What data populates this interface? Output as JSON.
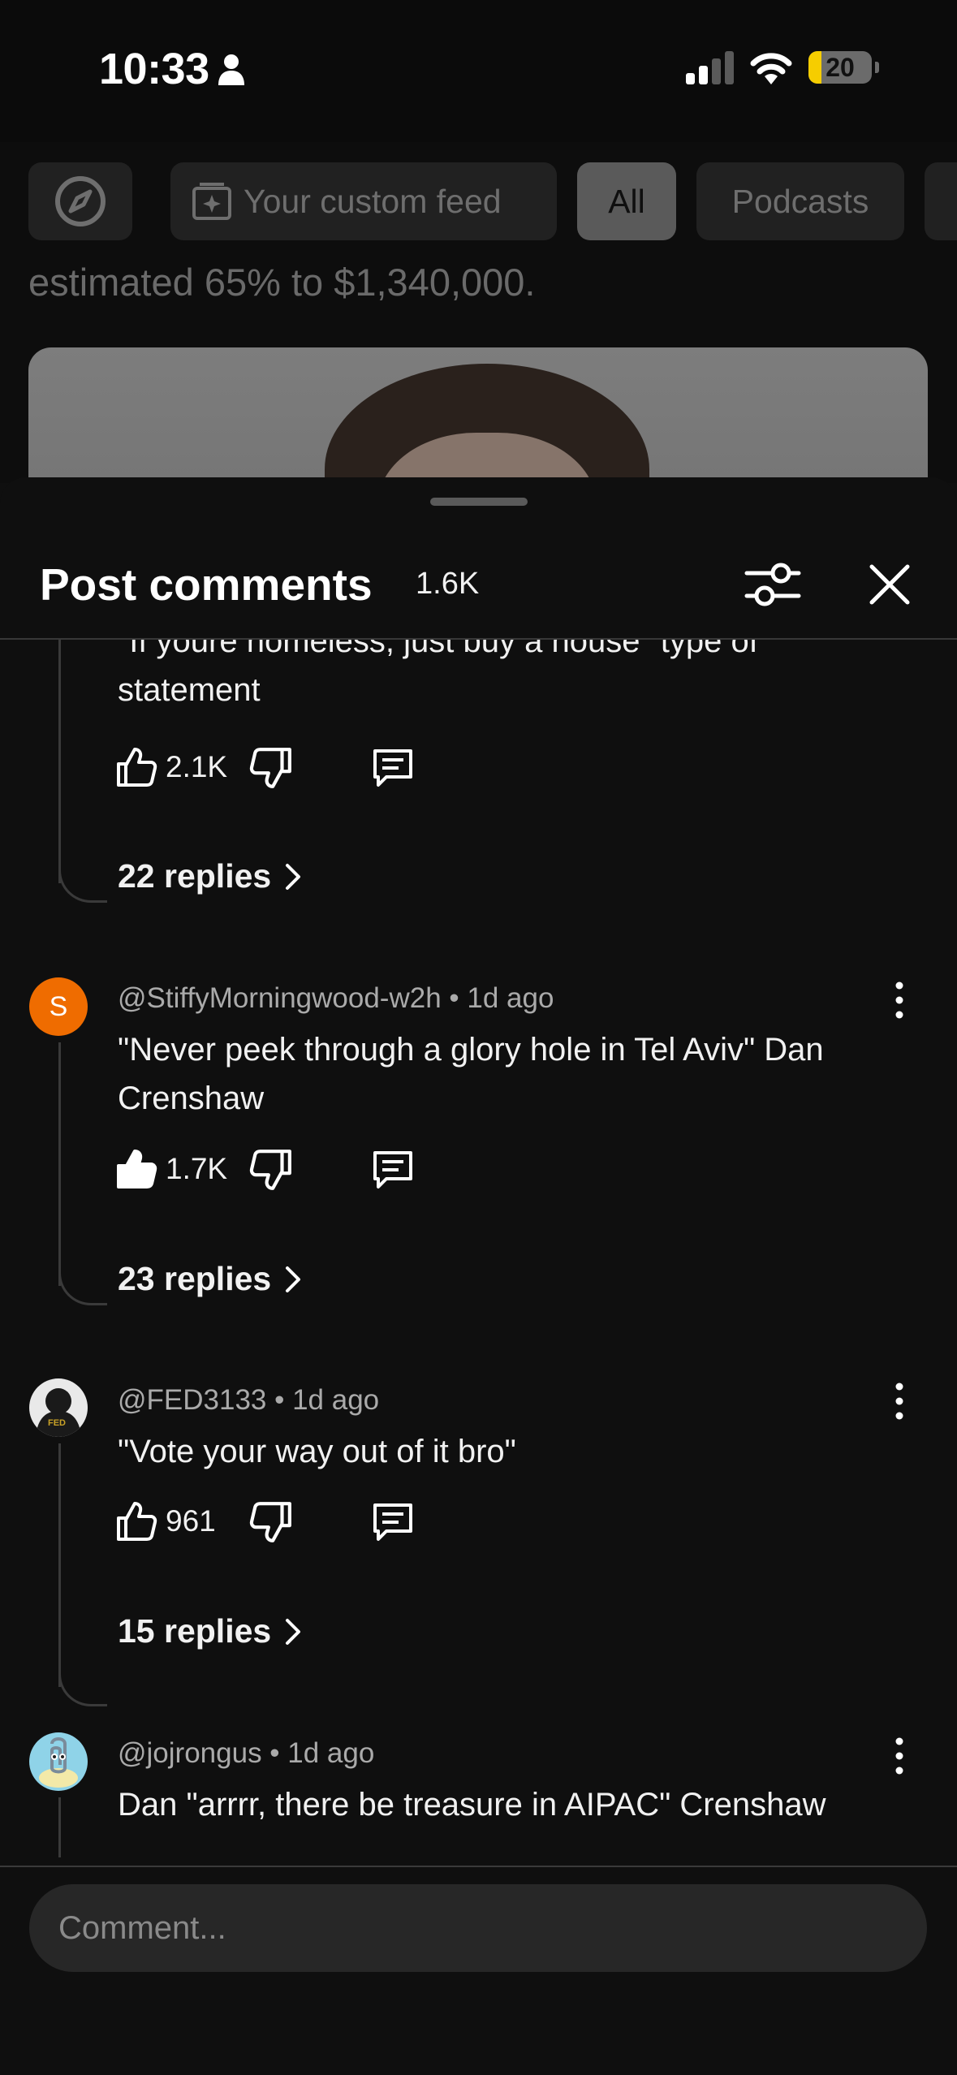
{
  "status_bar": {
    "time": "10:33",
    "battery": "20",
    "battery_level": 0.2
  },
  "feed": {
    "chips": [
      "Your custom feed",
      "All",
      "Podcasts"
    ],
    "selected_chip": "All",
    "caption": "estimated 65% to $1,340,000."
  },
  "comments_sheet": {
    "title": "Post comments",
    "count": "1.6K",
    "comments": [
      {
        "text": "\"If youre homeless, just buy a house\" type of statement",
        "likes": "2.1K",
        "liked": false,
        "replies": "22 replies"
      },
      {
        "author": "@StiffyMorningwood-w2h",
        "time": "1d ago",
        "meta": "@StiffyMorningwood-w2h • 1d ago",
        "avatar_letter": "S",
        "text": "\"Never peek through a glory hole in Tel Aviv\" Dan Crenshaw",
        "likes": "1.7K",
        "liked": true,
        "replies": "23 replies"
      },
      {
        "author": "@FED3133",
        "time": "1d ago",
        "meta": "@FED3133 • 1d ago",
        "avatar_label": "FED",
        "text": "\"Vote your way out of it bro\"",
        "likes": "961",
        "liked": false,
        "replies": "15 replies"
      },
      {
        "author": "@jojrongus",
        "time": "1d ago",
        "meta": "@jojrongus • 1d ago",
        "text": "Dan \"arrrr, there be treasure in AIPAC\" Crenshaw"
      }
    ],
    "composer_placeholder": "Comment..."
  },
  "icons": {
    "explore": "compass-icon",
    "custom_feed": "sparkle-feed-icon",
    "filter": "sliders-icon",
    "close": "close-icon",
    "like": "thumb-up-icon",
    "dislike": "thumb-down-icon",
    "reply": "comment-bubble-icon",
    "more": "more-vertical-icon"
  }
}
